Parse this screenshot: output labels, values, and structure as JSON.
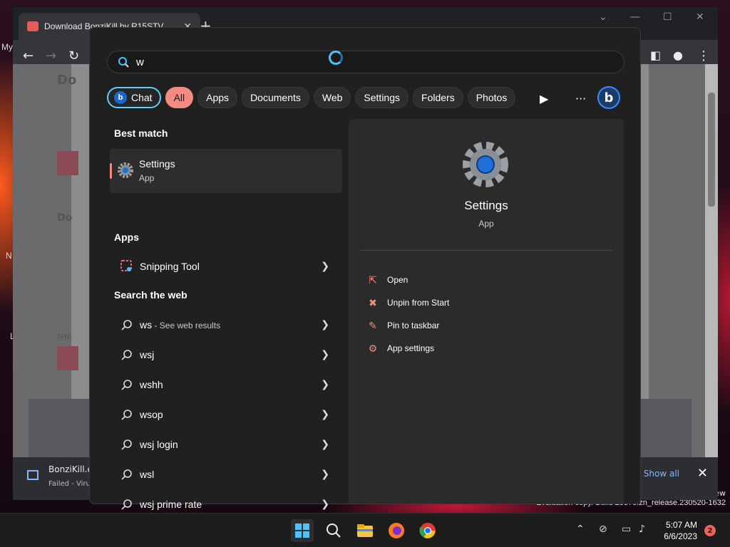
{
  "desktop": {
    "label_my": "My",
    "label_n": "N",
    "label_l": "L",
    "watermark_line1": "ew",
    "watermark_line2": "Evaluation copy. Build 25375.zn_release.230520-1632"
  },
  "browser": {
    "tab_title": "Download BonziKill by R15STV",
    "new_tab": "+",
    "page_letters": [
      "Do",
      "Do",
      "SHA"
    ],
    "download": {
      "file_name": "BonziKill.e",
      "status": "Failed - Virus",
      "show_all": "Show all",
      "close": "✕"
    }
  },
  "search": {
    "query": "w",
    "filters": [
      "Chat",
      "All",
      "Apps",
      "Documents",
      "Web",
      "Settings",
      "Folders",
      "Photos"
    ],
    "active_filter": "All",
    "more": "···",
    "best_match_heading": "Best match",
    "best_match": {
      "name": "Settings",
      "type": "App"
    },
    "apps_heading": "Apps",
    "apps": [
      {
        "name": "Snipping Tool"
      }
    ],
    "web_heading": "Search the web",
    "web_first": {
      "term": "ws",
      "suffix": " - See web results"
    },
    "web_results": [
      "wsj",
      "wshh",
      "wsop",
      "wsj login",
      "wsl",
      "wsj prime rate"
    ],
    "detail": {
      "title": "Settings",
      "subtitle": "App",
      "actions": [
        "Open",
        "Unpin from Start",
        "Pin to taskbar",
        "App settings"
      ]
    }
  },
  "taskbar": {
    "time": "5:07 AM",
    "date": "6/6/2023",
    "notifications": "2"
  },
  "colors": {
    "accent": "#f28b82",
    "chat_border": "#60cdff",
    "panel_bg": "#202020"
  }
}
